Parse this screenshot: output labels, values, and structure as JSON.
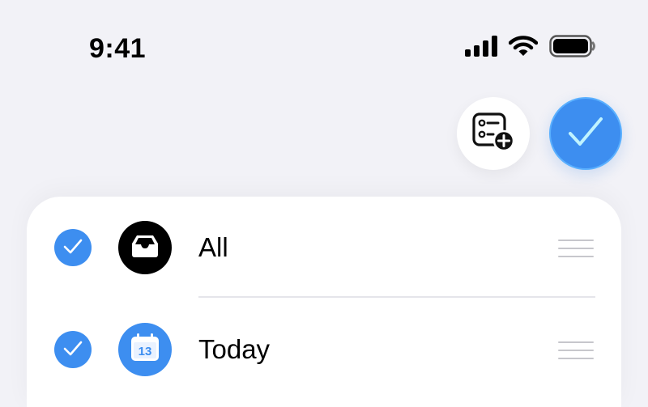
{
  "status_bar": {
    "time": "9:41",
    "icons": [
      "cellular-signal-icon",
      "wifi-icon",
      "battery-icon"
    ]
  },
  "toolbar": {
    "buttons": [
      "add-list-icon",
      "checkmark-icon"
    ]
  },
  "lists": [
    {
      "label": "All",
      "icon": "tray-icon",
      "checked": true
    },
    {
      "label": "Today",
      "icon": "calendar-icon",
      "calendar_day": "13",
      "checked": true
    }
  ],
  "colors": {
    "background": "#f2f2f7",
    "accent": "#3d8ef0",
    "card": "#ffffff",
    "separator": "#e5e5ea",
    "handle": "#c7c7cc"
  }
}
